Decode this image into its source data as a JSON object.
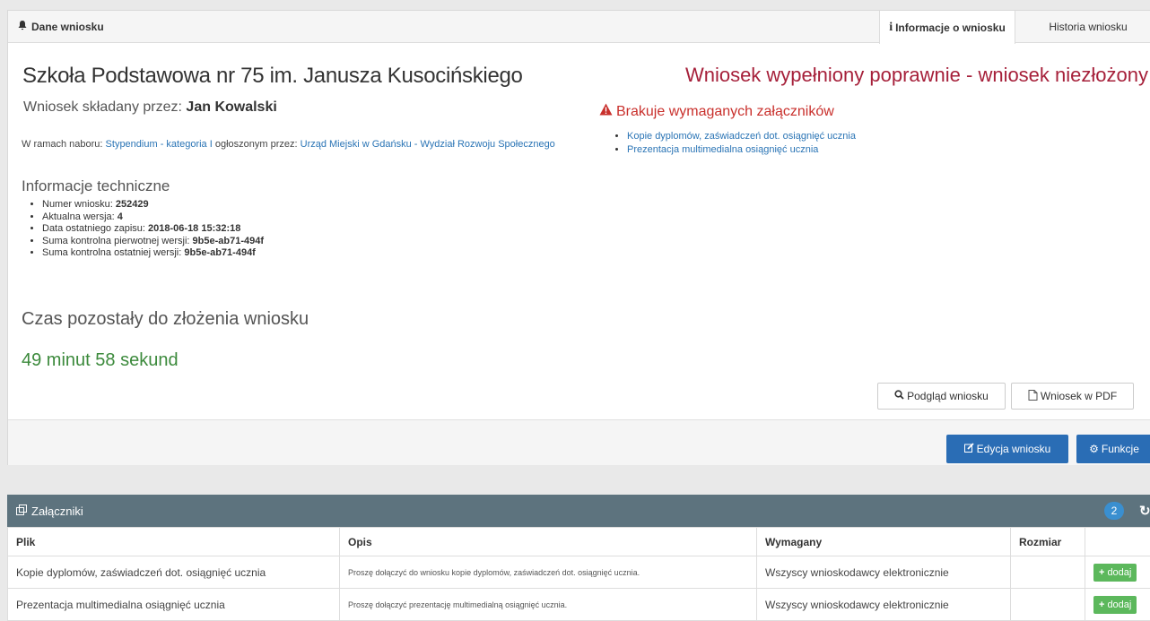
{
  "panel": {
    "title": "Dane wniosku",
    "tabs": [
      {
        "label": "Informacje o wniosku",
        "active": true
      },
      {
        "label": "Historia wniosku",
        "active": false
      }
    ]
  },
  "application": {
    "school": "Szkoła Podstawowa nr 75 im. Janusza Kusocińskiego",
    "submitted_by_label": "Wniosek składany przez:",
    "submitted_by_name": "Jan Kowalski",
    "nabor_prefix": "W ramach naboru:",
    "nabor_link": "Stypendium - kategoria I",
    "announced_by_label": "ogłoszonym przez:",
    "announced_by_link": "Urząd Miejski w Gdańsku - Wydział Rozwoju Społecznego",
    "status": "Wniosek wypełniony poprawnie - wniosek niezłożony"
  },
  "tech": {
    "title": "Informacje techniczne",
    "items": [
      {
        "label": "Numer wniosku:",
        "value": "252429"
      },
      {
        "label": "Aktualna wersja:",
        "value": "4"
      },
      {
        "label": "Data ostatniego zapisu:",
        "value": "2018-06-18 15:32:18"
      },
      {
        "label": "Suma kontrolna pierwotnej wersji:",
        "value": "9b5e-ab71-494f"
      },
      {
        "label": "Suma kontrolna ostatniej wersji:",
        "value": "9b5e-ab71-494f"
      }
    ]
  },
  "time": {
    "title": "Czas pozostały do złożenia wniosku",
    "value": "49 minut 58 sekund"
  },
  "missing": {
    "title": "Brakuje wymaganych załączników",
    "items": [
      "Kopie dyplomów, zaświadczeń dot. osiągnięć ucznia",
      "Prezentacja multimedialna osiągnięć ucznia"
    ]
  },
  "buttons": {
    "preview": "Podgląd wniosku",
    "pdf": "Wniosek w PDF",
    "edit": "Edycja wniosku",
    "functions": "Funkcje"
  },
  "attachments": {
    "title": "Załączniki",
    "count": "2",
    "columns": [
      "Plik",
      "Opis",
      "Wymagany",
      "Rozmiar",
      ""
    ],
    "rows": [
      {
        "file": "Kopie dyplomów, zaświadczeń dot. osiągnięć ucznia",
        "desc": "Proszę dołączyć do wniosku kopie dyplomów, zaświadczeń dot. osiągnięć ucznia.",
        "required": "Wszyscy wnioskodawcy elektronicznie",
        "size": "",
        "action": "dodaj"
      },
      {
        "file": "Prezentacja multimedialna osiągnięć ucznia",
        "desc": "Proszę dołączyć prezentację multimedialną osiągnięć ucznia.",
        "required": "Wszyscy wnioskodawcy elektronicznie",
        "size": "",
        "action": "dodaj"
      }
    ]
  },
  "colors": {
    "status": "#a6203a",
    "warning": "#c9302c",
    "time": "#3c8a3c",
    "primary": "#2a6db5",
    "success": "#5cb85c",
    "attachments_header": "#5d737e"
  }
}
